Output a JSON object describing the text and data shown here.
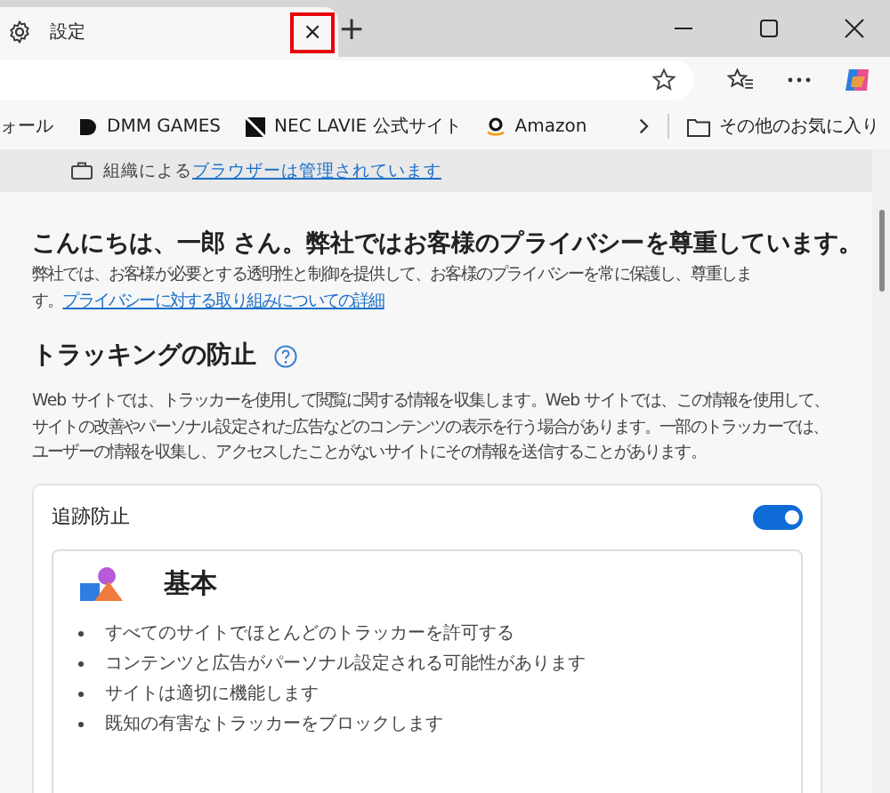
{
  "tab": {
    "title": "設定",
    "selected": true,
    "close_label": "×",
    "close_highlighted": true
  },
  "new_tab_label": "+",
  "bookmarks": [
    {
      "kind": "cut",
      "label": "ォール"
    },
    {
      "kind": "dmm",
      "label": "DMM GAMES"
    },
    {
      "kind": "nec",
      "label": "NEC LAVIE 公式サイト"
    },
    {
      "kind": "amazon",
      "label": "Amazon"
    }
  ],
  "other_favorites": "その他のお気に入り",
  "managed_banner": {
    "text": "組織による",
    "link": "ブラウザーは管理されています"
  },
  "greeting": {
    "title": "こんにちは、一郎 さん。弊社ではお客様のプライバシーを尊重しています。",
    "body": "弊社では、お客様が必要とする透明性と制御を提供して、お客様のプライバシーを常に保護し、尊重します。",
    "link": "プライバシーに対する取り組みについての詳細"
  },
  "tracking": {
    "heading": "トラッキングの防止",
    "description": "Web サイトでは、トラッカーを使用して閲覧に関する情報を収集します。Web サイトでは、この情報を使用して、サイトの改善やパーソナル設定された広告などのコンテンツの表示を行う場合があります。一部のトラッカーでは、ユーザーの情報を収集し、アクセスしたことがないサイトにその情報を送信することがあります。",
    "toggle_label": "追跡防止",
    "on": true,
    "option": {
      "title": "基本",
      "bullets": [
        "すべてのサイトでほとんどのトラッカーを許可する",
        "コンテンツと広告がパーソナル設定される可能性があります",
        "サイトは適切に機能します",
        "既知の有害なトラッカーをブロックします"
      ]
    }
  }
}
